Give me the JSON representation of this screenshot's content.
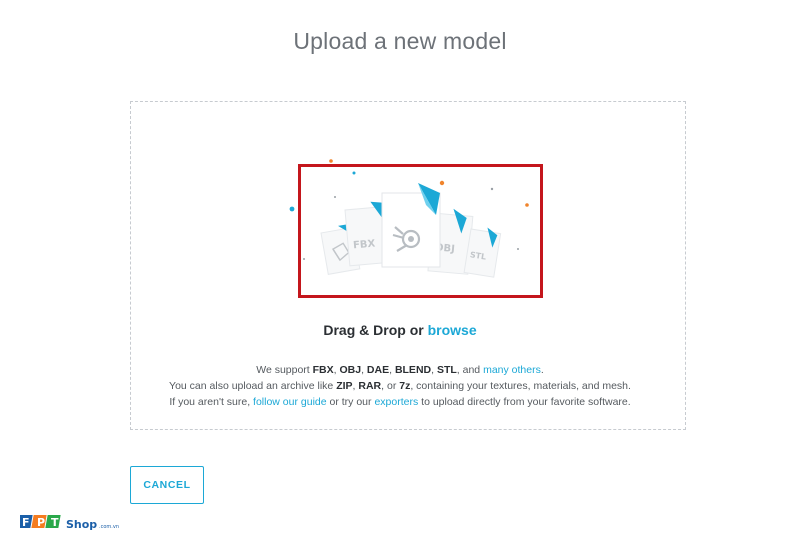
{
  "page": {
    "title": "Upload a new model"
  },
  "illustration": {
    "file_labels": [
      "FBX",
      "OBJ",
      "STL"
    ],
    "center_icon": "blender-logo-icon",
    "left_icon": "dae-shape-icon"
  },
  "dropzone": {
    "drag_text": "Drag & Drop or",
    "browse_link": "browse",
    "line1": {
      "prefix": "We support ",
      "fbx": "FBX",
      "sep1": ", ",
      "obj": "OBJ",
      "sep2": ", ",
      "dae": "DAE",
      "sep3": ", ",
      "blend": "BLEND",
      "sep4": ", ",
      "stl": "STL",
      "and": ", and ",
      "many_others": "many others",
      "end": "."
    },
    "line2": {
      "prefix": "You can also upload an archive like ",
      "zip": "ZIP",
      "sep1": ", ",
      "rar": "RAR",
      "or": ", or ",
      "sevenz": "7z",
      "suffix": ", containing your textures, materials, and mesh."
    },
    "line3": {
      "prefix": "If you aren't sure, ",
      "guide_link": "follow our guide",
      "middle": " or try our ",
      "exporters_link": "exporters",
      "suffix": " to upload directly from your favorite software."
    }
  },
  "actions": {
    "cancel_label": "CANCEL"
  },
  "watermark": {
    "brand_letters": "FPT",
    "brand_suffix": "Shop",
    "brand_domain": ".com.vn"
  },
  "colors": {
    "accent": "#1ca8d6",
    "highlight": "#c4161c",
    "dot_orange": "#f0842c",
    "brand_blue": "#1b5fa8",
    "brand_orange": "#f47c20",
    "brand_green": "#2aa84a"
  }
}
